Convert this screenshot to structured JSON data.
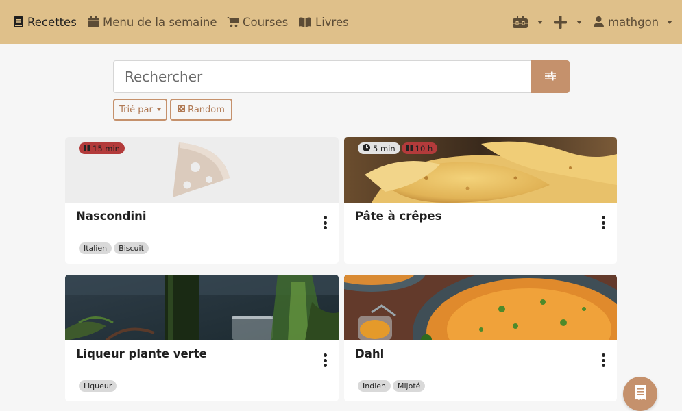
{
  "nav": {
    "recipes": "Recettes",
    "week_menu": "Menu de la semaine",
    "shopping": "Courses",
    "books": "Livres",
    "user": "mathgon",
    "icons": [
      "book-icon",
      "calendar-icon",
      "cart-icon",
      "open-book-icon",
      "toolbox-icon",
      "plus-icon",
      "user-icon"
    ]
  },
  "search": {
    "placeholder": "Rechercher",
    "value": ""
  },
  "controls": {
    "sort_label": "Trié par",
    "random_label": "Random"
  },
  "colors": {
    "navbar": "#dfc08a",
    "accent": "#c5916c",
    "rest_badge": "#b33b3b",
    "background": "#f6f6f6"
  },
  "recipes": [
    {
      "name": "Nascondini",
      "prep": "",
      "rest": "15 min",
      "tags": [
        "Italien",
        "Biscuit"
      ],
      "image": "pizza-placeholder"
    },
    {
      "name": "Pâte à crêpes",
      "prep": "5 min",
      "rest": "10 h",
      "tags": [],
      "image": "crepes-photo"
    },
    {
      "name": "Liqueur plante verte",
      "prep": "",
      "rest": "",
      "tags": [
        "Liqueur"
      ],
      "image": "liqueur-photo"
    },
    {
      "name": "Dahl",
      "prep": "",
      "rest": "",
      "tags": [
        "Indien",
        "Mijoté"
      ],
      "image": "dahl-photo"
    }
  ]
}
